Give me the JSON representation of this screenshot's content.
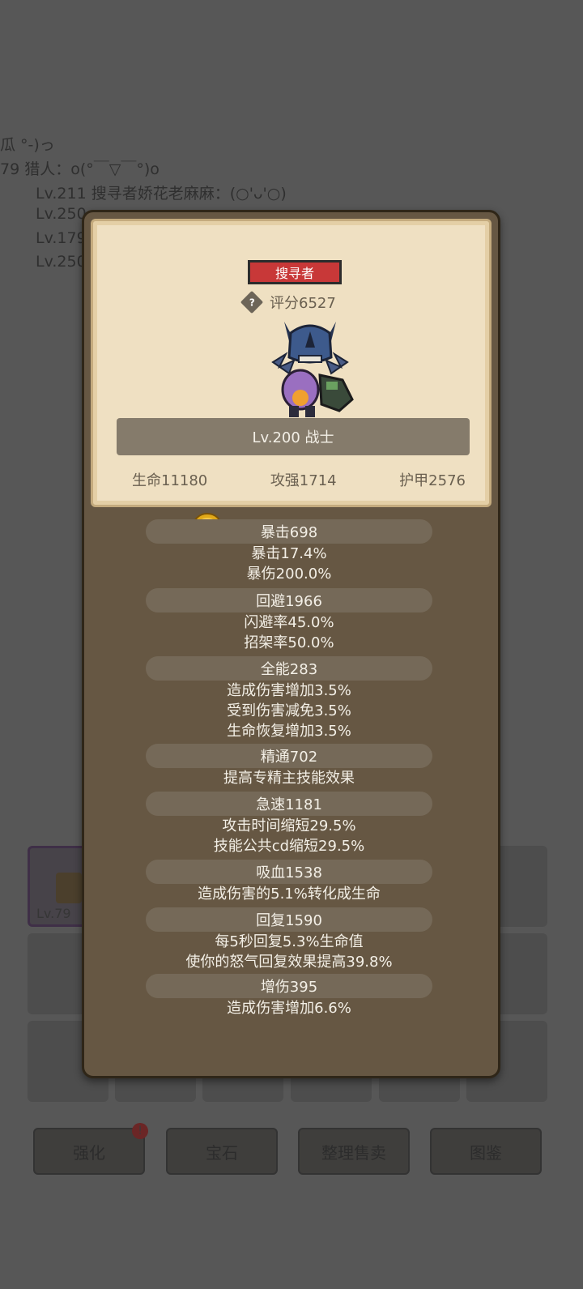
{
  "background": {
    "chat_lines": [
      "瓜 °-)っ",
      "79 猎人：o(°￣▽￣°)o",
      "Lv.211 搜寻者娇花老麻麻：(○'ᴗ'○)",
      "Lv.250",
      "Lv.179",
      "Lv.250"
    ],
    "slot_level": "Lv.79",
    "buttons": [
      "强化",
      "宝石",
      "整理售卖",
      "图鉴"
    ],
    "alert_badge": "!"
  },
  "panel": {
    "rank_label": "搜寻者",
    "help_icon_glyph": "?",
    "score": "评分6527",
    "level_class": "Lv.200 战士",
    "main_stats": [
      "生命11180",
      "攻强1714",
      "护甲2576"
    ],
    "stats": [
      {
        "header": "暴击698",
        "details": [
          "暴击17.4%",
          "暴伤200.0%"
        ]
      },
      {
        "header": "回避1966",
        "details": [
          "闪避率45.0%",
          "招架率50.0%"
        ]
      },
      {
        "header": "全能283",
        "details": [
          "造成伤害增加3.5%",
          "受到伤害减免3.5%",
          "生命恢复增加3.5%"
        ]
      },
      {
        "header": "精通702",
        "details": [
          "提高专精主技能效果"
        ]
      },
      {
        "header": "急速1181",
        "details": [
          "攻击时间缩短29.5%",
          "技能公共cd缩短29.5%"
        ]
      },
      {
        "header": "吸血1538",
        "details": [
          "造成伤害的5.1%转化成生命"
        ]
      },
      {
        "header": "回复1590",
        "details": [
          "每5秒回复5.3%生命值",
          "使你的怒气回复效果提高39.8%"
        ]
      },
      {
        "header": "增伤395",
        "details": [
          "造成伤害增加6.6%"
        ]
      }
    ]
  },
  "colors": {
    "rank_badge": "#c83838",
    "panel_bg": "#665743",
    "parchment": "#efe0c2"
  }
}
